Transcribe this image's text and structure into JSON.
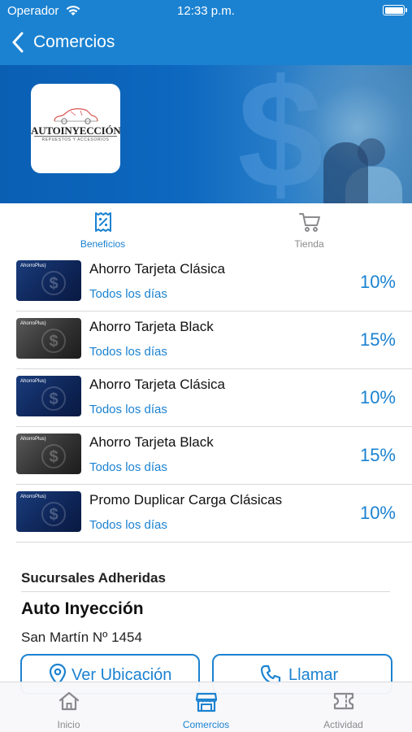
{
  "status_bar": {
    "carrier": "Operador",
    "time": "12:33 p.m."
  },
  "nav": {
    "title": "Comercios"
  },
  "merchant_logo": {
    "name": "AUTOINYECCIÓN",
    "tagline": "REPUESTOS Y ACCESORIOS"
  },
  "tabs": [
    {
      "label": "Beneficios",
      "icon": "discount-receipt-icon",
      "active": true
    },
    {
      "label": "Tienda",
      "icon": "shopping-cart-icon",
      "active": false
    }
  ],
  "benefits": [
    {
      "title": "Ahorro Tarjeta Clásica",
      "days": "Todos los días",
      "percent": "10%",
      "card": "blue",
      "card_brand": "AhorroPlus)"
    },
    {
      "title": "Ahorro Tarjeta Black",
      "days": "Todos los días",
      "percent": "15%",
      "card": "black",
      "card_brand": "AhorroPlus)"
    },
    {
      "title": "Ahorro Tarjeta Clásica",
      "days": "Todos los días",
      "percent": "10%",
      "card": "blue",
      "card_brand": "AhorroPlus)"
    },
    {
      "title": "Ahorro Tarjeta Black",
      "days": "Todos los días",
      "percent": "15%",
      "card": "black",
      "card_brand": "AhorroPlus)"
    },
    {
      "title": "Promo Duplicar Carga Clásicas",
      "days": "Todos los días",
      "percent": "10%",
      "card": "blue",
      "card_brand": "AhorroPlus)"
    }
  ],
  "branches": {
    "section_title": "Sucursales Adheridas",
    "name": "Auto Inyección",
    "address": "San Martín Nº 1454",
    "location_button": "Ver Ubicación",
    "call_button": "Llamar"
  },
  "bottom_tabs": [
    {
      "label": "Inicio",
      "icon": "home-icon",
      "active": false
    },
    {
      "label": "Comercios",
      "icon": "store-icon",
      "active": true
    },
    {
      "label": "Actividad",
      "icon": "ticket-icon",
      "active": false
    }
  ],
  "colors": {
    "primary": "#1b82d1",
    "inactive": "#8a8a8e",
    "text": "#111111",
    "separator": "#d8d8dc"
  }
}
